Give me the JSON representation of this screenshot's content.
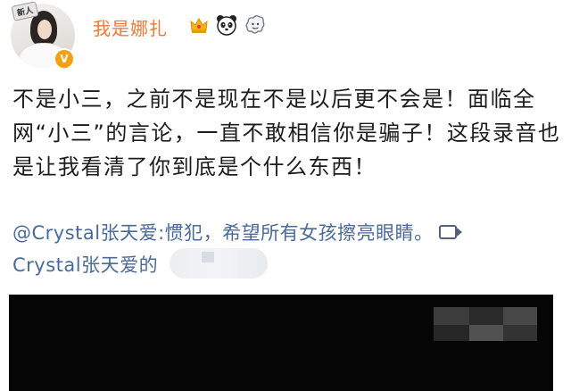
{
  "header": {
    "avatar_badge": "新人",
    "username": "我是娜扎",
    "icons": [
      "crown-icon",
      "panda-icon",
      "cloud-icon"
    ]
  },
  "post": {
    "text": "不是小三，之前不是现在不是以后更不会是！面临全网“小三”的言论，一直不敢相信你是骗子！这段录音也是让我看清了你到底是个什么东西！"
  },
  "quote": {
    "line1": "@Crystal张天爱:惯犯，希望所有女孩擦亮眼睛。",
    "line2": "Crystal张天爱的",
    "link_icon": "video-link-icon"
  },
  "colors": {
    "username": "#ee7a32",
    "link": "#4a6a9a",
    "text": "#1c1c1c",
    "verified_badge": "#f2a114",
    "video_bg": "#050505"
  }
}
